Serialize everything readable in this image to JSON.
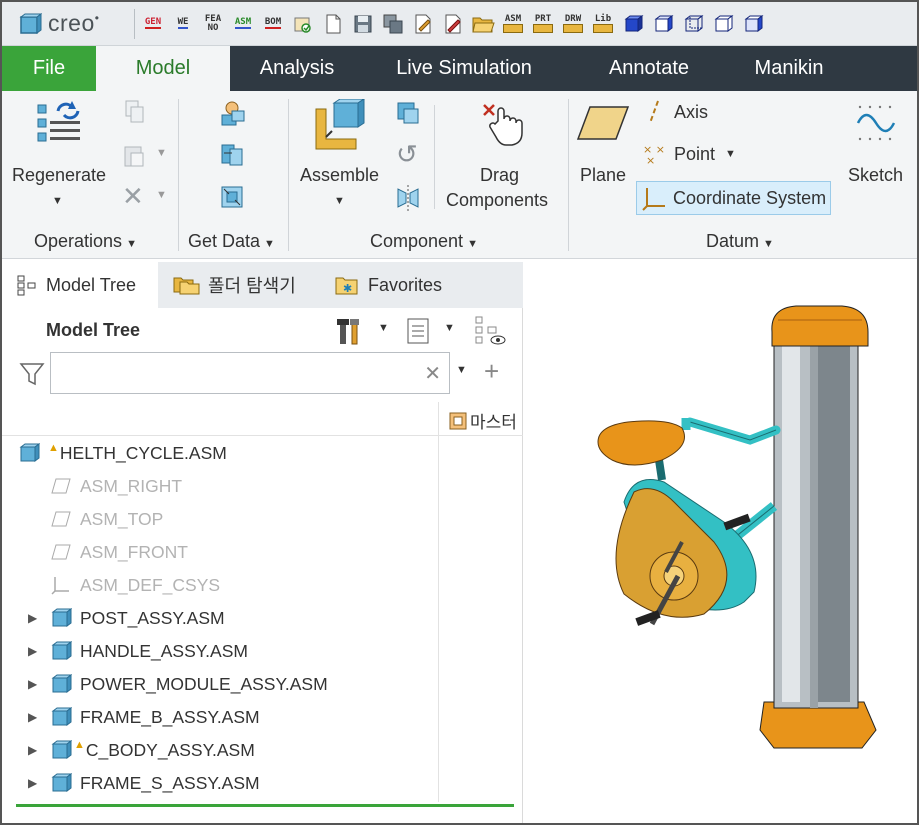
{
  "app": {
    "logo_text": "creo"
  },
  "quick_access": {
    "icons": [
      {
        "name": "gen-icon",
        "lines": [
          "GEN"
        ]
      },
      {
        "name": "we-icon",
        "lines": [
          "WE"
        ]
      },
      {
        "name": "fea-no-icon",
        "lines": [
          "FEA",
          "NO"
        ]
      },
      {
        "name": "asm-icon",
        "lines": [
          "ASM"
        ]
      },
      {
        "name": "bom-icon",
        "lines": [
          "BOM"
        ]
      }
    ],
    "folder_labels": [
      "ASM",
      "PRT",
      "DRW",
      "Lib"
    ]
  },
  "tabs": [
    "File",
    "Model",
    "Analysis",
    "Live Simulation",
    "Annotate",
    "Manikin"
  ],
  "active_tab": "Model",
  "ribbon": {
    "operations": {
      "label": "Operations",
      "regenerate": "Regenerate"
    },
    "get_data": {
      "label": "Get Data"
    },
    "component": {
      "label": "Component",
      "assemble": "Assemble",
      "drag_line1": "Drag",
      "drag_line2": "Components"
    },
    "datum": {
      "label": "Datum",
      "plane": "Plane",
      "axis": "Axis",
      "point": "Point",
      "csys": "Coordinate System",
      "sketch": "Sketch"
    }
  },
  "panel": {
    "tabs": [
      "Model Tree",
      "폴더 탐색기",
      "Favorites"
    ],
    "title": "Model Tree",
    "search": {
      "value": "",
      "placeholder": ""
    },
    "column_header": "마스터"
  },
  "tree": {
    "root": "HELTH_CYCLE.ASM",
    "datums": [
      "ASM_RIGHT",
      "ASM_TOP",
      "ASM_FRONT",
      "ASM_DEF_CSYS"
    ],
    "items": [
      "POST_ASSY.ASM",
      "HANDLE_ASSY.ASM",
      "POWER_MODULE_ASSY.ASM",
      "FRAME_B_ASSY.ASM",
      "C_BODY_ASSY.ASM",
      "FRAME_S_ASSY.ASM"
    ]
  },
  "colors": {
    "file_tab": "#3aa43a",
    "active_tab_text": "#2a7b2a",
    "tabbar": "#2f3942",
    "warning": "#e0a000"
  }
}
